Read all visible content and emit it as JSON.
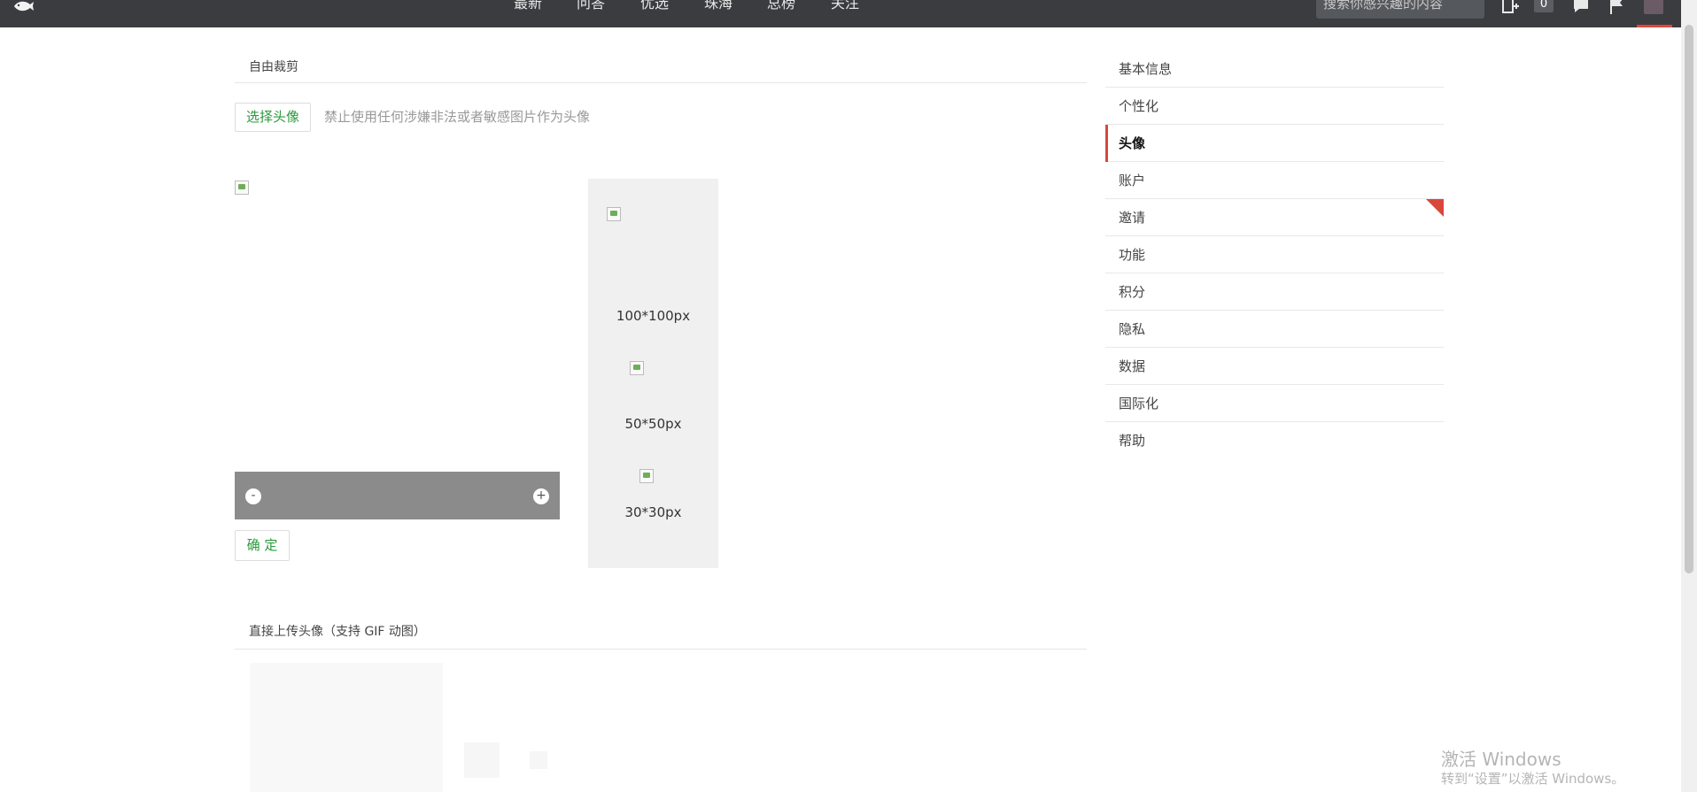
{
  "topnav": {
    "items": [
      "最新",
      "问答",
      "优选",
      "珠海",
      "总榜",
      "关注"
    ],
    "search_placeholder": "搜索你感兴趣的内容",
    "notification_count": "0"
  },
  "crop_section": {
    "title": "自由裁剪",
    "select_button": "选择头像",
    "hint": "禁止使用任何涉嫌非法或者敏感图片作为头像",
    "zoom_out": "-",
    "zoom_in": "+",
    "confirm_button": "确 定",
    "previews": [
      {
        "label": "100*100px"
      },
      {
        "label": "50*50px"
      },
      {
        "label": "30*30px"
      }
    ]
  },
  "upload_section": {
    "title": "直接上传头像（支持 GIF 动图）"
  },
  "sidebar": {
    "items": [
      {
        "label": "基本信息"
      },
      {
        "label": "个性化"
      },
      {
        "label": "头像"
      },
      {
        "label": "账户"
      },
      {
        "label": "邀请"
      },
      {
        "label": "功能"
      },
      {
        "label": "积分"
      },
      {
        "label": "隐私"
      },
      {
        "label": "数据"
      },
      {
        "label": "国际化"
      },
      {
        "label": "帮助"
      }
    ],
    "active_index": 2
  },
  "watermark": {
    "line1": "激活 Windows",
    "line2": "转到“设置”以激活 Windows。"
  },
  "colors": {
    "topbar": "#3a3c40",
    "accent": "#d9473c",
    "button_text": "#2a9a3c"
  }
}
